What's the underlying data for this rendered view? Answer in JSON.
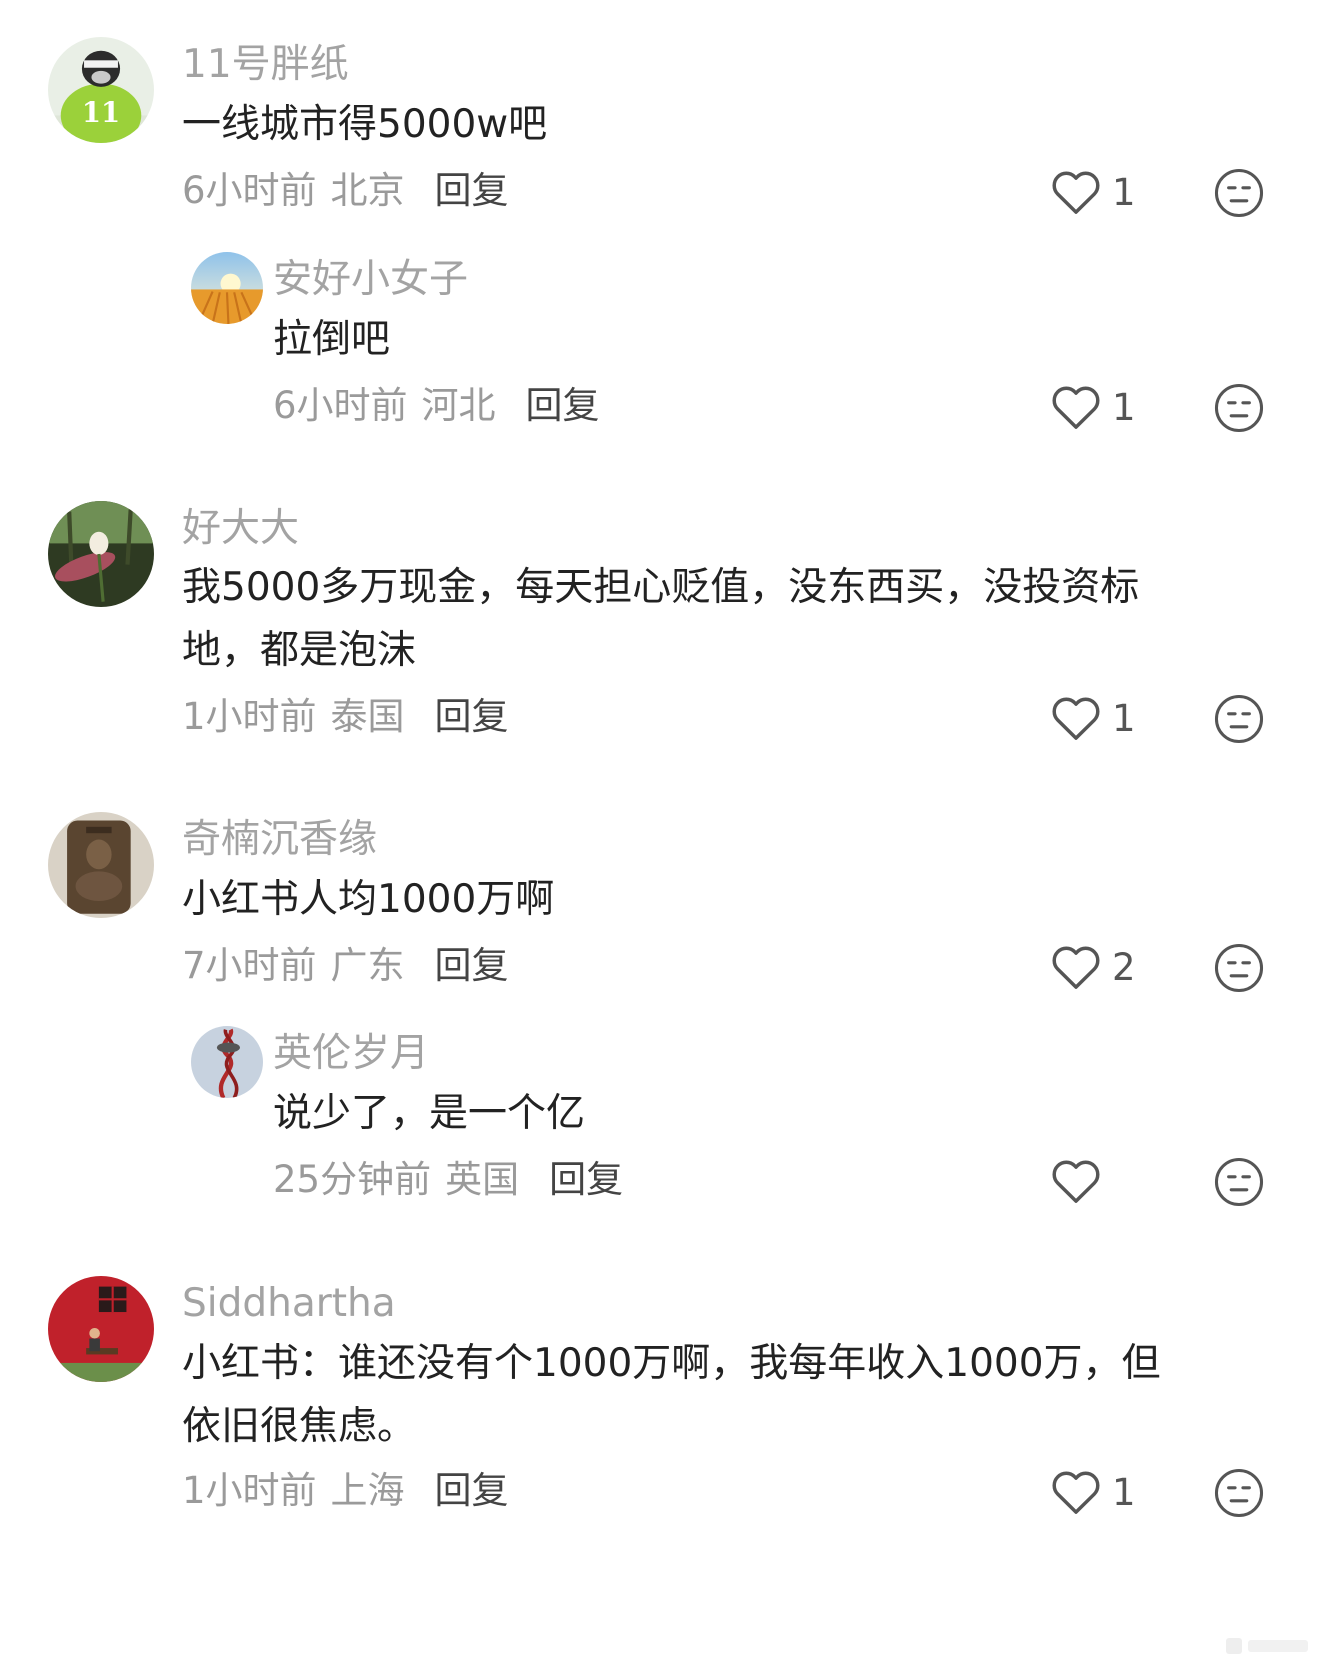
{
  "labels": {
    "reply": "回复"
  },
  "comments": [
    {
      "name": "11号胖纸",
      "text": "一线城市得5000w吧",
      "time": "6小时前",
      "location": "北京",
      "likes": "1",
      "avatar": "avatar-11-character"
    },
    {
      "name": "安好小女子",
      "text": "拉倒吧",
      "time": "6小时前",
      "location": "河北",
      "likes": "1",
      "avatar": "avatar-wheat-field"
    },
    {
      "name": "好大大",
      "text_lines": [
        "我5000多万现金，每天担心贬值，没东西买，没投资标",
        "地，都是泡沫"
      ],
      "time": "1小时前",
      "location": "泰国",
      "likes": "1",
      "avatar": "avatar-lotus-flower"
    },
    {
      "name": "奇楠沉香缘",
      "text": "小红书人均1000万啊",
      "time": "7小时前",
      "location": "广东",
      "likes": "2",
      "avatar": "avatar-carved-agarwood"
    },
    {
      "name": "英伦岁月",
      "text": "说少了，是一个亿",
      "time": "25分钟前",
      "location": "英国",
      "likes": "",
      "avatar": "avatar-orbit-tower"
    },
    {
      "name": "Siddhartha",
      "text_lines": [
        "小红书：谁还没有个1000万啊，我每年收入1000万，但",
        "依旧很焦虑。"
      ],
      "time": "1小时前",
      "location": "上海",
      "likes": "1",
      "avatar": "avatar-red-barn-person"
    }
  ],
  "icons": {
    "like": "heart-outline-icon",
    "dislike": "neutral-face-icon"
  },
  "colors": {
    "name": "#a3a3a3",
    "text": "#222222",
    "meta": "#9a9a9a",
    "reply": "#444444",
    "icon": "#555555"
  }
}
